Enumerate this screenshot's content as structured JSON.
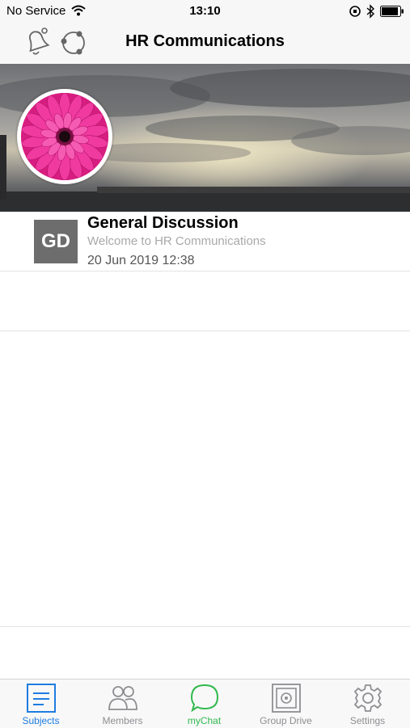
{
  "status_bar": {
    "carrier": "No Service",
    "time": "13:10"
  },
  "nav": {
    "title": "HR Communications",
    "left_icons": [
      "bell-icon",
      "sync-icon"
    ]
  },
  "subjects": [
    {
      "badge": "GD",
      "title": "General Discussion",
      "subtitle": "Welcome to HR Communications",
      "date": "20 Jun 2019 12:38"
    }
  ],
  "tabs": [
    {
      "label": "Subjects",
      "icon": "subjects-icon",
      "active": true
    },
    {
      "label": "Members",
      "icon": "members-icon",
      "active": false
    },
    {
      "label": "myChat",
      "icon": "chat-icon",
      "active": false
    },
    {
      "label": "Group Drive",
      "icon": "drive-icon",
      "active": false
    },
    {
      "label": "Settings",
      "icon": "gear-icon",
      "active": false
    }
  ],
  "colors": {
    "accent": "#1e7ce0",
    "chat": "#31b94e",
    "badge": "#6d6d6d",
    "flower": "#e0248a"
  }
}
